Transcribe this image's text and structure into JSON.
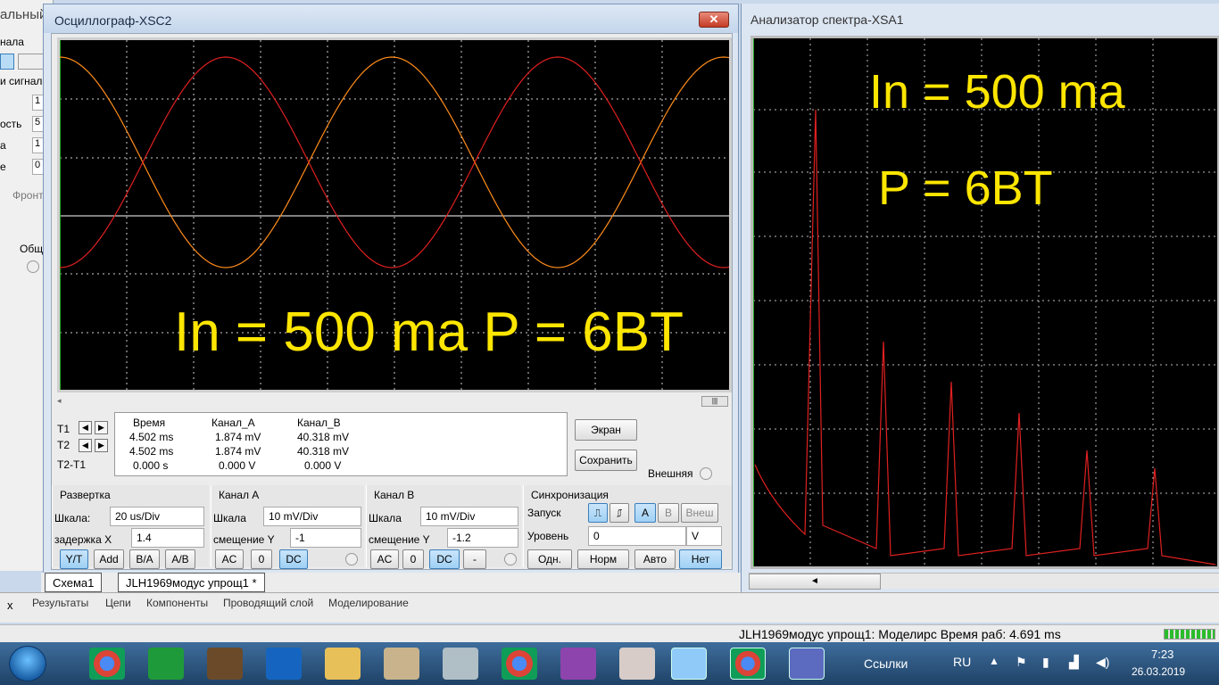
{
  "background_app": {
    "title": "альный",
    "labels": [
      "нала",
      "и сигнала",
      "ость",
      "а",
      "е",
      "Фронт",
      "Общ"
    ],
    "values": [
      "1",
      "5",
      "1",
      "0"
    ]
  },
  "oscilloscope": {
    "title": "Осциллограф-XSC2",
    "close_label": "✕",
    "annotation": "In = 500 ma   P = 6BT",
    "readout": {
      "headers": [
        "Время",
        "Канал_А",
        "Канал_B"
      ],
      "rows": [
        {
          "label": "T1",
          "time": "4.502 ms",
          "cha": "1.874 mV",
          "chb": "40.318 mV"
        },
        {
          "label": "T2",
          "time": "4.502 ms",
          "cha": "1.874 mV",
          "chb": "40.318 mV"
        },
        {
          "label": "T2-T1",
          "time": "0.000 s",
          "cha": "0.000 V",
          "chb": "0.000 V"
        }
      ]
    },
    "buttons": {
      "screen": "Экран",
      "save": "Сохранить",
      "external": "Внешняя"
    },
    "sweep": {
      "title": "Развертка",
      "scale_label": "Шкала:",
      "scale_value": "20 us/Div",
      "delay_label": "задержка X",
      "delay_value": "1.4",
      "modes": [
        "Y/T",
        "Add",
        "B/A",
        "A/B"
      ]
    },
    "channel_a": {
      "title": "Канал А",
      "scale_label": "Шкала",
      "scale_value": "10 mV/Div",
      "offset_label": "смещение Y",
      "offset_value": "-1",
      "coupling": [
        "AC",
        "0",
        "DC"
      ]
    },
    "channel_b": {
      "title": "Канал В",
      "scale_label": "Шкала",
      "scale_value": "10 mV/Div",
      "offset_label": "смещение Y",
      "offset_value": "-1.2",
      "coupling": [
        "AC",
        "0",
        "DC",
        "-"
      ]
    },
    "trigger": {
      "title": "Синхронизация",
      "edge_label": "Запуск",
      "sources": [
        "A",
        "B",
        "Внеш"
      ],
      "level_label": "Уровень",
      "level_value": "0",
      "level_unit": "V",
      "modes": [
        "Одн.",
        "Норм",
        "Авто",
        "Нет"
      ]
    }
  },
  "spectrum": {
    "title": "Анализатор спектра-XSA1",
    "annotation_line1": "In = 500 ma",
    "annotation_line2": "P = 6BT",
    "scroll_arrow": "◄"
  },
  "tabs": {
    "tab1": "Схема1",
    "tab2": "JLH1969модус упрощ1 *"
  },
  "lower_tabs": {
    "close": "x",
    "items": [
      "Результаты",
      "Цепи",
      "Компоненты",
      "Проводящий слой",
      "Моделирование"
    ]
  },
  "status": {
    "text": "JLH1969модус упрощ1: Моделирс Время раб: 4.691 ms"
  },
  "taskbar": {
    "links": "Ссылки",
    "lang": "RU",
    "time": "7:23",
    "date": "26.03.2019"
  },
  "colors": {
    "trace_a": "#ff8c1a",
    "trace_b": "#e02020",
    "annotation": "#ffe600",
    "grid": "#cfcfcf",
    "spectrum": "#e02020"
  }
}
